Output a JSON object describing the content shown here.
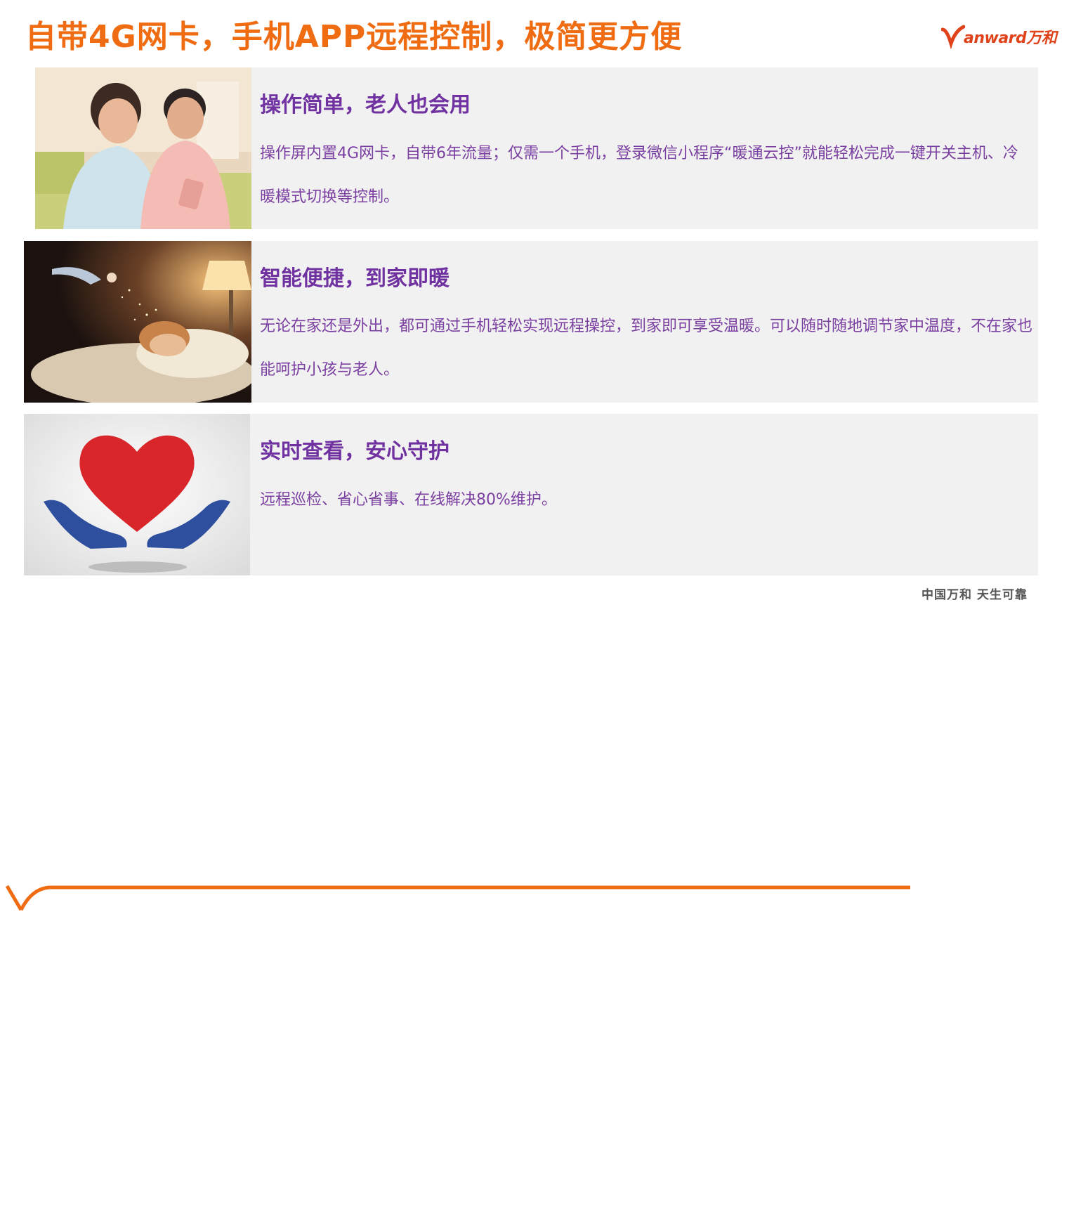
{
  "title": "自带4G网卡，手机APP远程控制，极简更方便",
  "logo": {
    "text": "anward万和"
  },
  "sections": [
    {
      "heading": "操作简单，老人也会用",
      "body": "操作屏内置4G网卡，自带6年流量；仅需一个手机，登录微信小程序“暖通云控”就能轻松完成一键开关主机、冷暖模式切换等控制。",
      "image": "elderly-couple-with-phone"
    },
    {
      "heading": "智能便捷，到家即暖",
      "body": "无论在家还是外出，都可通过手机轻松实现远程操控，到家即可享受温暖。可以随时随地调节家中温度，不在家也能呵护小孩与老人。",
      "image": "child-sleeping-under-lamp"
    },
    {
      "heading": "实时查看，安心守护",
      "body": "远程巡检、省心省事、在线解决80%维护。",
      "image": "heart-in-hands"
    }
  ],
  "footer": {
    "slogan": "中国万和 天生可靠"
  },
  "colors": {
    "title": "#ef6c12",
    "heading": "#7032a0",
    "body": "#7a3fa0",
    "panel": "#f1f1f1"
  }
}
